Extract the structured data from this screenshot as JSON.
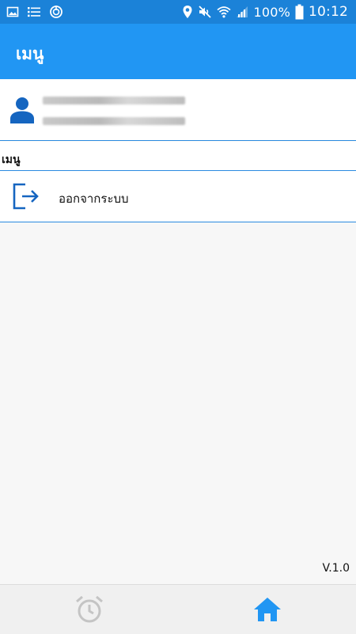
{
  "status_bar": {
    "battery_percent": "100%",
    "time": "10:12",
    "left_icons": [
      "image-icon",
      "list-icon",
      "power-ring-icon"
    ],
    "right_icons": [
      "location-pin-icon",
      "muted-speaker-icon",
      "wifi-icon",
      "signal-icon",
      "battery-icon"
    ],
    "color": "#1b82d8"
  },
  "app_bar": {
    "title": "เมนู",
    "color": "#2196f3"
  },
  "profile": {
    "avatar_icon": "person-icon",
    "name_redacted": true
  },
  "menu": {
    "section_title": "เมนู",
    "items": [
      {
        "icon": "logout-icon",
        "label": "ออกจากระบบ"
      }
    ]
  },
  "version": "V.1.0",
  "bottom_nav": {
    "items": [
      {
        "icon": "alarm-clock-icon",
        "active": false
      },
      {
        "icon": "home-icon",
        "active": true
      }
    ],
    "active_color": "#2196f3",
    "inactive_color": "#c4c4c4"
  }
}
